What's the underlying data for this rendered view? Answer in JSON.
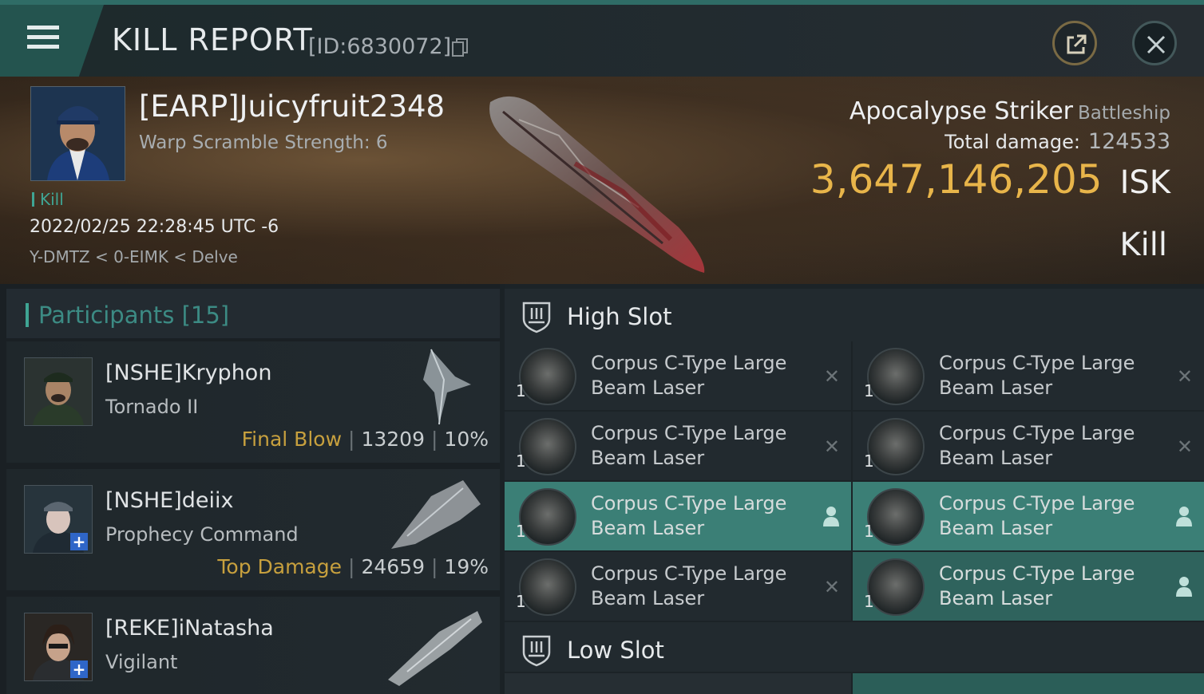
{
  "header": {
    "title": "KILL REPORT",
    "report_id": "[ID:6830072]",
    "menu_icon": "hamburger-menu-icon",
    "share_icon": "external-link-icon",
    "close_icon": "close-icon"
  },
  "victim": {
    "name": "[EARP]Juicyfruit2348",
    "warp_scramble": "Warp Scramble Strength: 6",
    "tag": "Kill",
    "datetime": "2022/02/25 22:28:45 UTC -6",
    "location": "Y-DMTZ < 0-EIMK < Delve",
    "ship_name": "Apocalypse Striker",
    "ship_class": "Battleship",
    "damage_label": "Total damage:",
    "damage_value": "124533",
    "isk_value": "3,647,146,205",
    "isk_unit": "ISK",
    "result": "Kill"
  },
  "participants": {
    "title": "Participants [15]",
    "items": [
      {
        "name": "[NSHE]Kryphon",
        "ship": "Tornado II",
        "label": "Final Blow",
        "damage": "13209",
        "percent": "10%"
      },
      {
        "name": "[NSHE]deiix",
        "ship": "Prophecy Command",
        "label": "Top Damage",
        "damage": "24659",
        "percent": "19%"
      },
      {
        "name": "[REKE]iNatasha",
        "ship": "Vigilant"
      }
    ]
  },
  "fitting": {
    "high_slot_title": "High Slot",
    "low_slot_title": "Low Slot",
    "modules": [
      {
        "name": "Corpus C-Type Large Beam Laser",
        "qty": "1",
        "state": "destroyed"
      },
      {
        "name": "Corpus C-Type Large Beam Laser",
        "qty": "1",
        "state": "destroyed"
      },
      {
        "name": "Corpus C-Type Large Beam Laser",
        "qty": "1",
        "state": "destroyed"
      },
      {
        "name": "Corpus C-Type Large Beam Laser",
        "qty": "1",
        "state": "destroyed"
      },
      {
        "name": "Corpus C-Type Large Beam Laser",
        "qty": "1",
        "state": "dropped"
      },
      {
        "name": "Corpus C-Type Large Beam Laser",
        "qty": "1",
        "state": "dropped"
      },
      {
        "name": "Corpus C-Type Large Beam Laser",
        "qty": "1",
        "state": "destroyed"
      },
      {
        "name": "Corpus C-Type Large Beam Laser",
        "qty": "1",
        "state": "dropped"
      }
    ],
    "destroyed_glyph": "✕",
    "dropped_icon": "person-icon"
  },
  "colors": {
    "accent_teal": "#3fa594",
    "isk_gold": "#e8b54a",
    "label_gold": "#c7a03e",
    "fitted_bg": "#3b7f76"
  }
}
